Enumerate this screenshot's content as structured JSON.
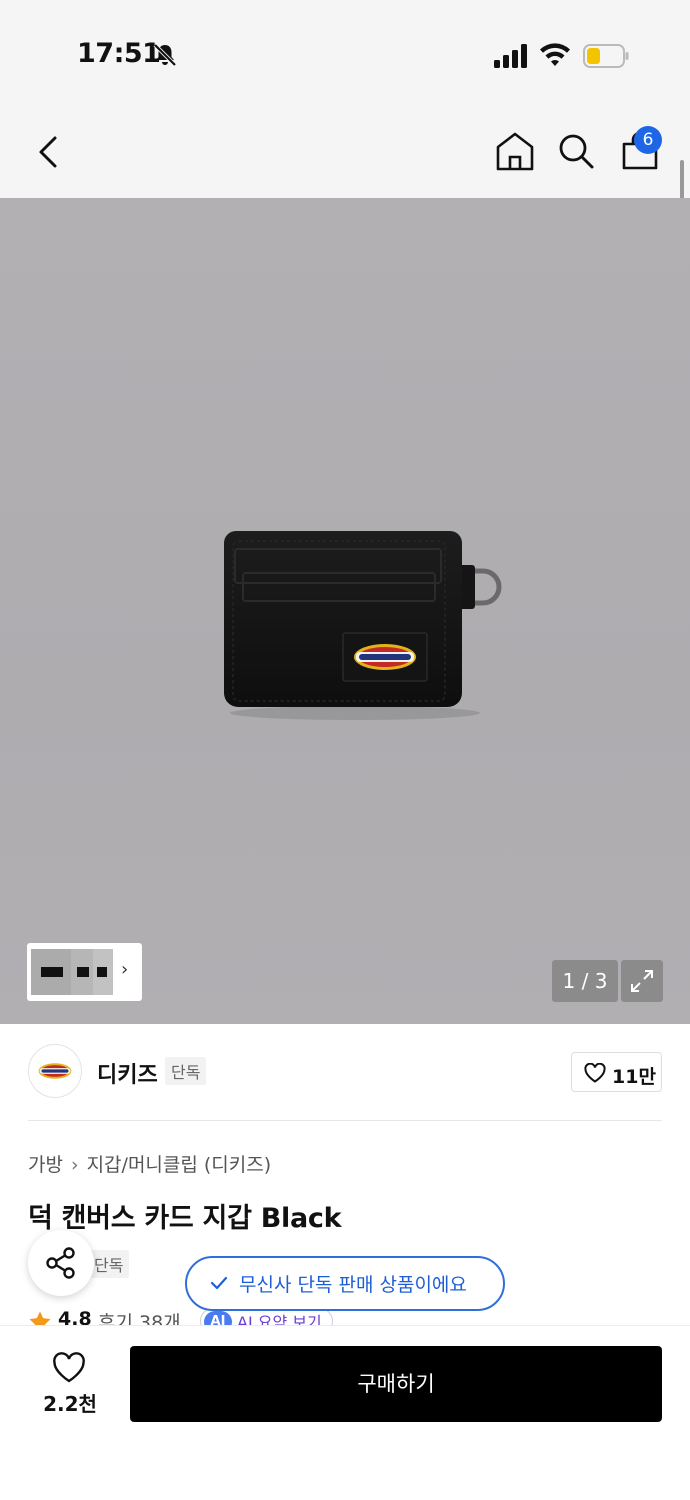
{
  "status_bar": {
    "time": "17:51"
  },
  "nav": {
    "cart_count": "6"
  },
  "gallery": {
    "page_counter": "1 / 3"
  },
  "brand": {
    "name": "디키즈",
    "tag": "단독",
    "like_count": "11만"
  },
  "breadcrumb": {
    "category": "가방",
    "separator": "›",
    "subcategory": "지갑/머니클립 (디키즈)"
  },
  "product": {
    "title": "덕 캔버스 카드 지갑 Black",
    "exclusive_tag": "단독",
    "rating": "4.8",
    "reviews": "후기 38개",
    "ai_summary_label": "AI 요약 보기",
    "ai_mark": "AI"
  },
  "toast": {
    "message": "무신사 단독 판매 상품이에요"
  },
  "bottom": {
    "wish_count": "2.2천",
    "buy_label": "구매하기"
  },
  "colors": {
    "accent": "#1e66e6",
    "buy_button": "#000000",
    "toast_border": "#2f6fdb"
  },
  "icons": [
    "bell-off-icon",
    "signal-icon",
    "wifi-icon",
    "battery-icon",
    "back-icon",
    "home-icon",
    "search-icon",
    "cart-icon",
    "expand-icon",
    "heart-icon",
    "share-icon",
    "check-icon",
    "star-icon"
  ]
}
